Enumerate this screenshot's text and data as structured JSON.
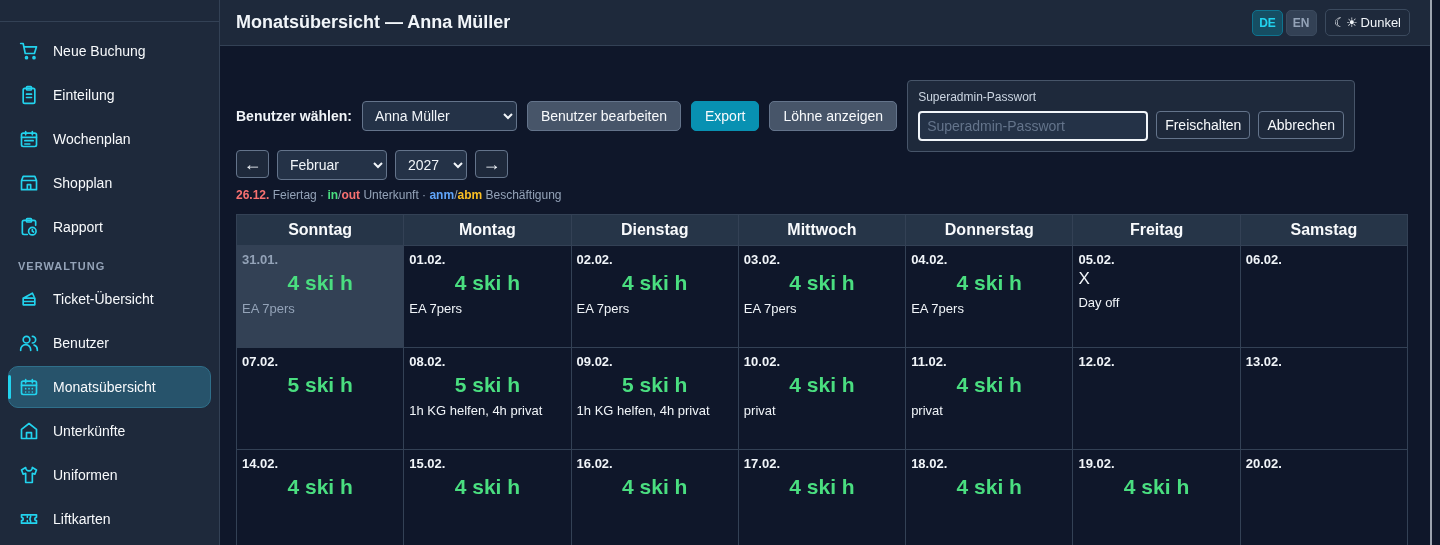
{
  "sidebar": {
    "sections": [
      {
        "items": [
          {
            "label": "Neue Buchung",
            "selected": false
          },
          {
            "label": "Einteilung",
            "selected": false
          },
          {
            "label": "Wochenplan",
            "selected": false
          },
          {
            "label": "Shopplan",
            "selected": false
          },
          {
            "label": "Rapport",
            "selected": false
          }
        ]
      },
      {
        "heading": "VERWALTUNG",
        "items": [
          {
            "label": "Ticket-Übersicht",
            "selected": false
          },
          {
            "label": "Benutzer",
            "selected": false
          },
          {
            "label": "Monatsübersicht",
            "selected": true
          },
          {
            "label": "Unterkünfte",
            "selected": false
          },
          {
            "label": "Uniformen",
            "selected": false
          },
          {
            "label": "Liftkarten",
            "selected": false
          }
        ]
      }
    ]
  },
  "header": {
    "title": "Monatsübersicht — Anna Müller",
    "languages": [
      {
        "label": "DE",
        "selected": true
      },
      {
        "label": "EN",
        "selected": false
      }
    ],
    "theme_button": {
      "icon": "☾☀",
      "label": "Dunkel"
    }
  },
  "toolbar": {
    "user_label": "Benutzer wählen:",
    "user_select": "Anna Müller",
    "buttons": [
      {
        "label": "Benutzer bearbeiten",
        "kind": "secondary"
      },
      {
        "label": "Export",
        "kind": "primary"
      },
      {
        "label": "Löhne anzeigen",
        "kind": "secondary"
      }
    ]
  },
  "password_panel": {
    "label": "Superadmin-Passwort",
    "placeholder": "Superadmin-Passwort",
    "buttons": [
      "Freischalten",
      "Abbrechen"
    ]
  },
  "month_nav": {
    "prev": "←",
    "month": "Februar",
    "year": "2027",
    "next": "→"
  },
  "legend": [
    {
      "text": "26.12.",
      "kind": "holiday"
    },
    {
      "text": " Feiertag · ",
      "kind": "plain"
    },
    {
      "text": "in",
      "kind": "in"
    },
    {
      "text": "/",
      "kind": "plain"
    },
    {
      "text": "out",
      "kind": "out"
    },
    {
      "text": " Unterkunft · ",
      "kind": "plain"
    },
    {
      "text": "anm",
      "kind": "anm"
    },
    {
      "text": "/",
      "kind": "plain"
    },
    {
      "text": "abm",
      "kind": "abm"
    },
    {
      "text": " Beschäftigung",
      "kind": "plain"
    }
  ],
  "calendar": {
    "columns": [
      "Sonntag",
      "Montag",
      "Dienstag",
      "Mittwoch",
      "Donnerstag",
      "Freitag",
      "Samstag"
    ],
    "weeks": [
      [
        {
          "date": "31.01.",
          "outside_month": true,
          "hours": "4 ski h",
          "note": "EA 7pers"
        },
        {
          "date": "01.02.",
          "outside_month": false,
          "hours": "4 ski h",
          "note": "EA 7pers"
        },
        {
          "date": "02.02.",
          "outside_month": false,
          "hours": "4 ski h",
          "note": "EA 7pers"
        },
        {
          "date": "03.02.",
          "outside_month": false,
          "hours": "4 ski h",
          "note": "EA 7pers"
        },
        {
          "date": "04.02.",
          "outside_month": false,
          "hours": "4 ski h",
          "note": "EA 7pers"
        },
        {
          "date": "05.02.",
          "outside_month": false,
          "mark": "X",
          "note": "Day off"
        },
        {
          "date": "06.02.",
          "outside_month": false
        }
      ],
      [
        {
          "date": "07.02.",
          "outside_month": false,
          "hours": "5 ski h"
        },
        {
          "date": "08.02.",
          "outside_month": false,
          "hours": "5 ski h",
          "note": "1h KG helfen, 4h privat"
        },
        {
          "date": "09.02.",
          "outside_month": false,
          "hours": "5 ski h",
          "note": "1h KG helfen, 4h privat"
        },
        {
          "date": "10.02.",
          "outside_month": false,
          "hours": "4 ski h",
          "note": "privat"
        },
        {
          "date": "11.02.",
          "outside_month": false,
          "hours": "4 ski h",
          "note": "privat"
        },
        {
          "date": "12.02.",
          "outside_month": false
        },
        {
          "date": "13.02.",
          "outside_month": false
        }
      ],
      [
        {
          "date": "14.02.",
          "outside_month": false,
          "hours": "4 ski h"
        },
        {
          "date": "15.02.",
          "outside_month": false,
          "hours": "4 ski h"
        },
        {
          "date": "16.02.",
          "outside_month": false,
          "hours": "4 ski h"
        },
        {
          "date": "17.02.",
          "outside_month": false,
          "hours": "4 ski h"
        },
        {
          "date": "18.02.",
          "outside_month": false,
          "hours": "4 ski h"
        },
        {
          "date": "19.02.",
          "outside_month": false,
          "hours": "4 ski h"
        },
        {
          "date": "20.02.",
          "outside_month": false
        }
      ]
    ]
  }
}
